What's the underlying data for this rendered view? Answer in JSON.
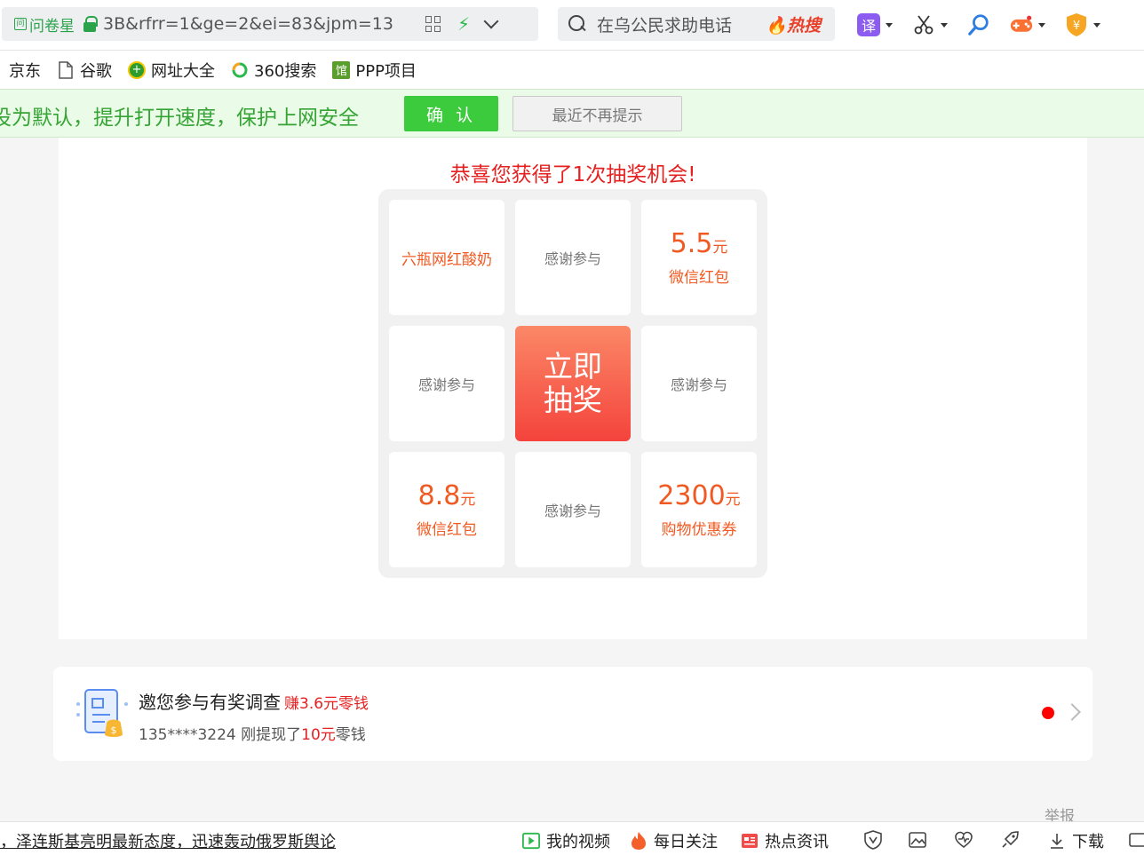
{
  "browser": {
    "tab_site_name": "问卷星",
    "url_fragment": "3B&rfrr=1&ge=2&ei=83&jpm=13",
    "search_query": "在乌公民求助电话",
    "hot_search_label": "热搜",
    "translate_label": "译"
  },
  "bookmarks": [
    "京东",
    "谷歌",
    "网址大全",
    "360搜索",
    "PPP项目"
  ],
  "notice": {
    "message": "设为默认，提升打开速度，保护上网安全",
    "confirm_label": "确 认",
    "dismiss_label": "最近不再提示"
  },
  "lottery": {
    "congrats": "恭喜您获得了1次抽奖机会!",
    "draw_button": [
      "立即",
      "抽奖"
    ],
    "cells": {
      "c1": {
        "label": "六瓶网红酸奶"
      },
      "c2": {
        "label": "感谢参与"
      },
      "c3": {
        "amount": "5.5",
        "unit": "元",
        "label": "微信红包"
      },
      "c4": {
        "label": "感谢参与"
      },
      "c6": {
        "label": "感谢参与"
      },
      "c7": {
        "amount": "8.8",
        "unit": "元",
        "label": "微信红包"
      },
      "c8": {
        "label": "感谢参与"
      },
      "c9": {
        "amount": "2300",
        "unit": "元",
        "label": "购物优惠券"
      }
    }
  },
  "survey": {
    "title": "邀您参与有奖调查",
    "earn": "赚3.6元零钱",
    "ticker_prefix": "135****3224 刚提现了",
    "ticker_amount": "10元",
    "ticker_suffix": "零钱"
  },
  "report_label": "举报",
  "statusbar": {
    "news": "，泽连斯基亮明最新态度，迅速轰动俄罗斯舆论",
    "my_video": "我的视频",
    "daily_follow": "每日关注",
    "hot_news": "热点资讯",
    "download": "下载"
  },
  "colors": {
    "accent_red": "#e52020",
    "prize_orange": "#f05a22",
    "confirm_green": "#3ccb3c",
    "draw_gradient_top": "#fb8867",
    "draw_gradient_bottom": "#f4433c"
  }
}
